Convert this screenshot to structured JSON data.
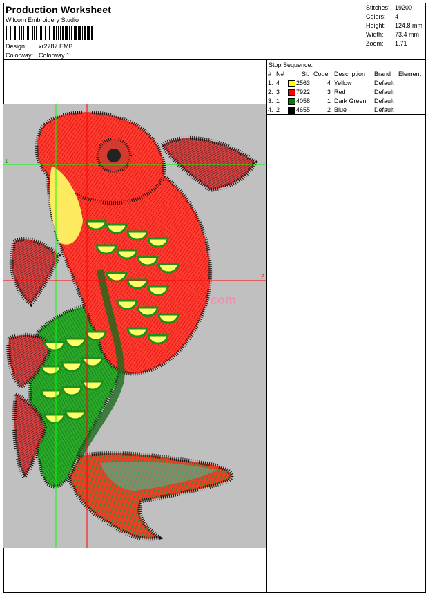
{
  "header": {
    "title": "Production Worksheet",
    "subtitle": "Wilcom  Embroidery Studio",
    "design_label": "Design:",
    "design_value": "xr2787.EMB",
    "colorway_label": "Colorway:",
    "colorway_value": "Colorway 1"
  },
  "stats": [
    {
      "label": "Stitches:",
      "value": "19200"
    },
    {
      "label": "Colors:",
      "value": "4"
    },
    {
      "label": "Height:",
      "value": "124.8 mm"
    },
    {
      "label": "Width:",
      "value": "73.4 mm"
    },
    {
      "label": "Zoom:",
      "value": "1.71"
    }
  ],
  "stop_sequence": {
    "caption": "Stop Sequence:",
    "headers": {
      "num": "#",
      "n": "N#",
      "st": "St.",
      "code": "Code",
      "desc": "Description",
      "brand": "Brand",
      "element": "Element"
    },
    "rows": [
      {
        "num": "1.",
        "n": "4",
        "color": "#ffff00",
        "st": "2563",
        "code": "4",
        "desc": "Yellow",
        "brand": "Default"
      },
      {
        "num": "2.",
        "n": "3",
        "color": "#ff0000",
        "st": "7922",
        "code": "3",
        "desc": "Red",
        "brand": "Default"
      },
      {
        "num": "3.",
        "n": "1",
        "color": "#008000",
        "st": "4058",
        "code": "1",
        "desc": "Dark Green",
        "brand": "Default"
      },
      {
        "num": "4.",
        "n": "2",
        "color": "#000000",
        "st": "4655",
        "code": "2",
        "desc": "Blue",
        "brand": "Default"
      }
    ]
  },
  "design_view": {
    "marker_green": "1",
    "marker_red": "2",
    "watermark": "com",
    "colors": {
      "background": "#c0c0c0",
      "guide_green": "#00ff00",
      "guide_red": "#ff0000"
    }
  }
}
